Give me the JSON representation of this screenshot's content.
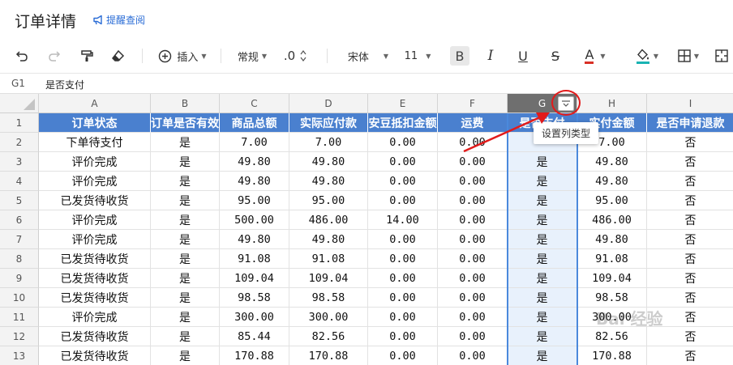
{
  "header": {
    "title": "订单详情",
    "remind_label": "提醒查阅"
  },
  "toolbar": {
    "insert_label": "插入",
    "format_label": "常规",
    "decimal_label": ".0",
    "font_label": "宋体",
    "size_label": "11",
    "bold_label": "B",
    "italic_label": "I",
    "underline_label": "U",
    "strike_label": "S",
    "fontcolor_label": "A",
    "colors": {
      "font_underline": "#d93026",
      "fill_underline": "#19b3b3"
    }
  },
  "formula": {
    "cell_ref": "G1",
    "content": "是否支付"
  },
  "grid": {
    "columns": [
      "A",
      "B",
      "C",
      "D",
      "E",
      "F",
      "G",
      "H",
      "I"
    ],
    "selected_column": "G",
    "headers": [
      "订单状态",
      "订单是否有效",
      "商品总额",
      "实际应付款",
      "安豆抵扣金额",
      "运费",
      "是否支付",
      "实付金额",
      "是否申请退款"
    ],
    "rows": [
      [
        "下单待支付",
        "是",
        "7.00",
        "7.00",
        "0.00",
        "0.00",
        "",
        "7.00",
        "否"
      ],
      [
        "评价完成",
        "是",
        "49.80",
        "49.80",
        "0.00",
        "0.00",
        "是",
        "49.80",
        "否"
      ],
      [
        "评价完成",
        "是",
        "49.80",
        "49.80",
        "0.00",
        "0.00",
        "是",
        "49.80",
        "否"
      ],
      [
        "已发货待收货",
        "是",
        "95.00",
        "95.00",
        "0.00",
        "0.00",
        "是",
        "95.00",
        "否"
      ],
      [
        "评价完成",
        "是",
        "500.00",
        "486.00",
        "14.00",
        "0.00",
        "是",
        "486.00",
        "否"
      ],
      [
        "评价完成",
        "是",
        "49.80",
        "49.80",
        "0.00",
        "0.00",
        "是",
        "49.80",
        "否"
      ],
      [
        "已发货待收货",
        "是",
        "91.08",
        "91.08",
        "0.00",
        "0.00",
        "是",
        "91.08",
        "否"
      ],
      [
        "已发货待收货",
        "是",
        "109.04",
        "109.04",
        "0.00",
        "0.00",
        "是",
        "109.04",
        "否"
      ],
      [
        "已发货待收货",
        "是",
        "98.58",
        "98.58",
        "0.00",
        "0.00",
        "是",
        "98.58",
        "否"
      ],
      [
        "评价完成",
        "是",
        "300.00",
        "300.00",
        "0.00",
        "0.00",
        "是",
        "300.00",
        "否"
      ],
      [
        "已发货待收货",
        "是",
        "85.44",
        "82.56",
        "0.00",
        "0.00",
        "是",
        "82.56",
        "否"
      ],
      [
        "已发货待收货",
        "是",
        "170.88",
        "170.88",
        "0.00",
        "0.00",
        "是",
        "170.88",
        "否"
      ]
    ]
  },
  "tooltip": {
    "text": "设置列类型"
  },
  "watermark": {
    "text": "Bai 经验"
  }
}
